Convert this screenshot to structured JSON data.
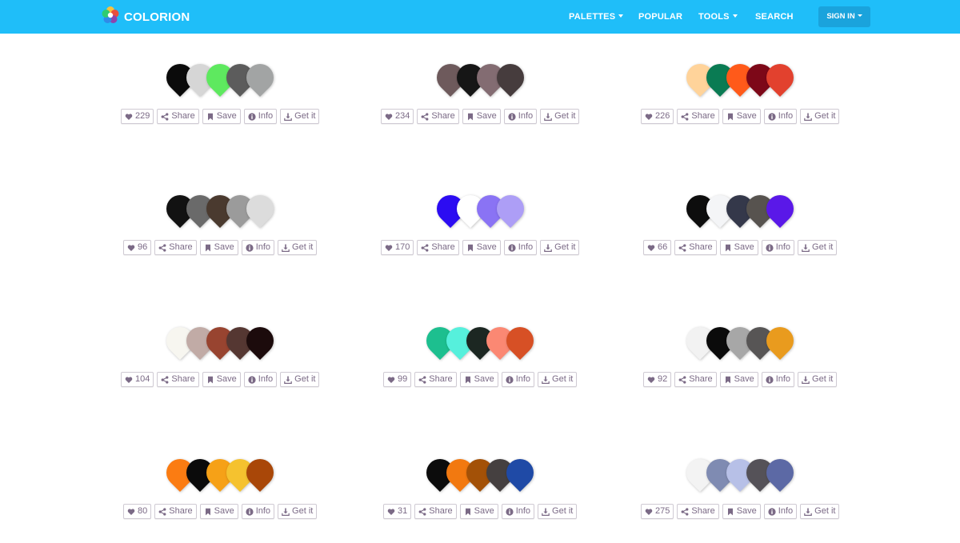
{
  "header": {
    "brand": "COLORION",
    "nav": {
      "palettes": "PALETTES",
      "popular": "POPULAR",
      "tools": "TOOLS",
      "search": "SEARCH",
      "signin": "SIGN IN"
    }
  },
  "button_labels": {
    "share": "Share",
    "save": "Save",
    "info": "Info",
    "get": "Get it"
  },
  "palettes": [
    {
      "likes": "229",
      "colors": [
        "#0b0b0b",
        "#d6d6d6",
        "#5ee95f",
        "#5c5c5c",
        "#a2a4a4"
      ]
    },
    {
      "likes": "234",
      "colors": [
        "#6e5a5c",
        "#161616",
        "#836c72",
        "#463c3d"
      ]
    },
    {
      "likes": "226",
      "colors": [
        "#ffd39a",
        "#0a7b53",
        "#ff5a1a",
        "#7d0818",
        "#e2412e"
      ]
    },
    {
      "likes": "96",
      "colors": [
        "#121212",
        "#6a6a6a",
        "#4a3a2f",
        "#9b9b9b",
        "#dcdcdc"
      ]
    },
    {
      "likes": "170",
      "colors": [
        "#2c0cf2",
        "#ffffff",
        "#8a73f4",
        "#ad9ef6"
      ]
    },
    {
      "likes": "66",
      "colors": [
        "#0d0d0d",
        "#f4f5f7",
        "#34384a",
        "#57534f",
        "#5a18e8"
      ]
    },
    {
      "likes": "104",
      "colors": [
        "#f7f6f0",
        "#c1aba6",
        "#984430",
        "#553732",
        "#1c0b0c"
      ]
    },
    {
      "likes": "99",
      "colors": [
        "#1dbf8f",
        "#56f0dc",
        "#1c2722",
        "#fb8873",
        "#d75025"
      ]
    },
    {
      "likes": "92",
      "colors": [
        "#f2f2f2",
        "#0b0b0b",
        "#a7a7a7",
        "#575555",
        "#e99b1e"
      ]
    },
    {
      "likes": "80",
      "colors": [
        "#fb7c12",
        "#0b0b0b",
        "#f6a117",
        "#f5c22f",
        "#a94708"
      ]
    },
    {
      "likes": "31",
      "colors": [
        "#0c0c0c",
        "#f27910",
        "#a35107",
        "#454040",
        "#1f4aa6"
      ]
    },
    {
      "likes": "275",
      "colors": [
        "#f3f3f3",
        "#7f8bb2",
        "#b7c0e7",
        "#555258",
        "#5c69a5"
      ]
    }
  ]
}
